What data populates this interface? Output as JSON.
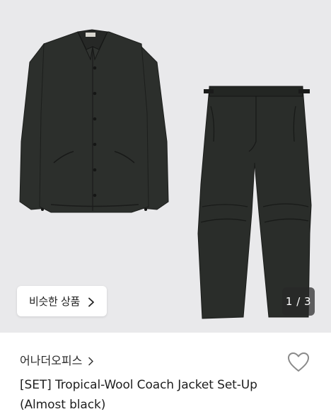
{
  "gallery": {
    "similar_button_label": "비슷한 상품",
    "counter": "1 / 3",
    "image_alt": "jacket and pants set"
  },
  "product": {
    "brand": "어나더오피스",
    "title": "[SET] Tropical-Wool Coach Jacket Set-Up (Almost black)"
  },
  "colors": {
    "background": "#e9e9eb",
    "garment": "#2c2f2c",
    "heart_stroke": "#8a8a8a"
  },
  "icons": {
    "similar_chevron": "chevron-right-icon",
    "brand_chevron": "chevron-right-icon",
    "wishlist": "heart-outline-icon"
  }
}
